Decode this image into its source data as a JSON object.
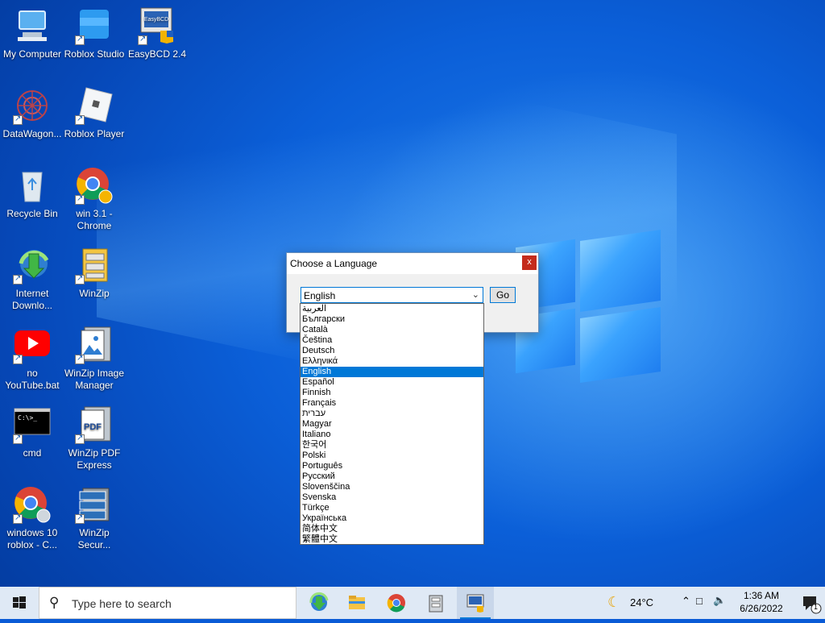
{
  "desktop": {
    "icons": [
      {
        "label": "My Computer",
        "icon": "computer-icon"
      },
      {
        "label": "Roblox Studio",
        "icon": "roblox-studio-icon"
      },
      {
        "label": "EasyBCD 2.4",
        "icon": "easybcd-icon",
        "badge": "EasyBCD"
      },
      {
        "label": "DataWagon...",
        "icon": "datawagon-icon"
      },
      {
        "label": "Roblox Player",
        "icon": "roblox-player-icon"
      },
      {
        "label": "Recycle Bin",
        "icon": "recycle-bin-icon"
      },
      {
        "label": "win 3.1 - Chrome",
        "icon": "chrome-profile-icon"
      },
      {
        "label": "Internet Downlo...",
        "icon": "internet-download-manager-icon"
      },
      {
        "label": "WinZip",
        "icon": "winzip-icon"
      },
      {
        "label": "no YouTube.bat",
        "icon": "youtube-icon"
      },
      {
        "label": "WinZip Image Manager",
        "icon": "winzip-image-manager-icon"
      },
      {
        "label": "cmd",
        "icon": "cmd-icon",
        "prompt": "C:\\>_"
      },
      {
        "label": "WinZip PDF Express",
        "icon": "winzip-pdf-icon",
        "badge": "PDF"
      },
      {
        "label": "windows 10 roblox - C...",
        "icon": "chrome-profile-icon"
      },
      {
        "label": "WinZip Secur...",
        "icon": "winzip-secure-icon"
      }
    ]
  },
  "dialog": {
    "title": "Choose a Language",
    "close_label": "x",
    "selected_language": "English",
    "go_label": "Go",
    "languages": [
      "العربية",
      "Български",
      "Català",
      "Čeština",
      "Deutsch",
      "Ελληνικά",
      "English",
      "Español",
      "Finnish",
      "Français",
      "עברית",
      "Magyar",
      "Italiano",
      "한국어",
      "Polski",
      "Português",
      "Русский",
      "Slovenščina",
      "Svenska",
      "Türkçe",
      "Українська",
      "简体中文",
      "繁體中文"
    ],
    "highlighted_index": 6
  },
  "taskbar": {
    "search_placeholder": "Type here to search",
    "apps": [
      "internet-download-manager-icon",
      "file-explorer-icon",
      "chrome-icon",
      "winzip-icon",
      "easybcd-icon"
    ],
    "active_app_index": 4,
    "weather": "24°C",
    "time": "1:36 AM",
    "date": "6/26/2022",
    "notification_count": "1"
  },
  "colors": {
    "accent": "#0078d7",
    "close_red": "#c42b1c",
    "taskbar": "#dfe9f5"
  }
}
